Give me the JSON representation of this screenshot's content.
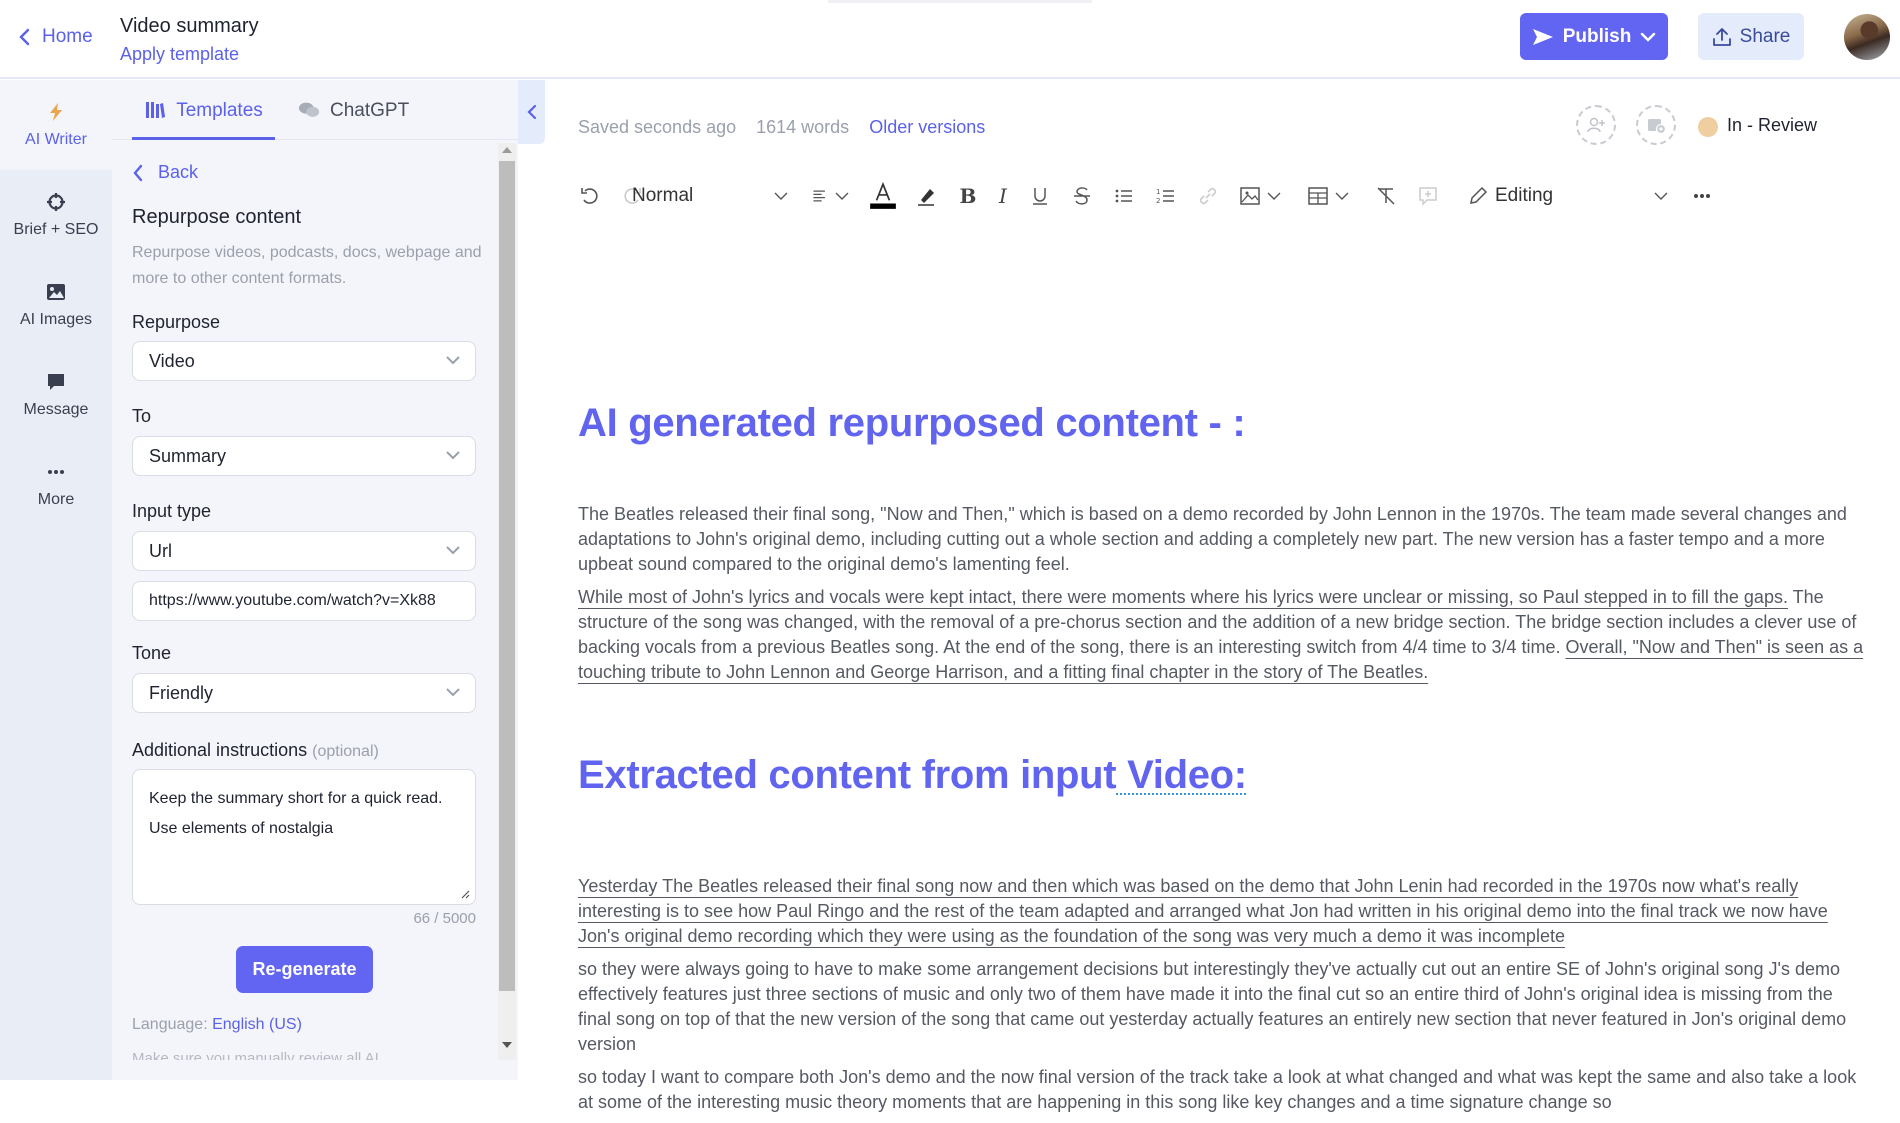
{
  "header": {
    "home_label": "Home",
    "doc_title": "Video summary",
    "apply_template_label": "Apply template",
    "publish_label": "Publish",
    "share_label": "Share",
    "accent_color": "#6264f2"
  },
  "rail": {
    "items": [
      {
        "label": "AI Writer",
        "icon": "lightning-icon",
        "active": true
      },
      {
        "label": "Brief + SEO",
        "icon": "crosshair-icon",
        "active": false
      },
      {
        "label": "AI Images",
        "icon": "image-icon",
        "active": false
      },
      {
        "label": "Message",
        "icon": "message-icon",
        "active": false
      },
      {
        "label": "More",
        "icon": "more-dots-icon",
        "active": false
      }
    ]
  },
  "panel": {
    "tabs": [
      {
        "label": "Templates",
        "icon": "books-icon",
        "active": true
      },
      {
        "label": "ChatGPT",
        "icon": "chat-bubbles-icon",
        "active": false
      }
    ],
    "back_label": "Back",
    "title": "Repurpose content",
    "description": "Repurpose videos, podcasts, docs, webpage and more to other content formats.",
    "fields": {
      "repurpose": {
        "label": "Repurpose",
        "value": "Video"
      },
      "to": {
        "label": "To",
        "value": "Summary"
      },
      "input_type": {
        "label": "Input type",
        "value": "Url"
      },
      "url": {
        "value": "https://www.youtube.com/watch?v=Xk88"
      },
      "tone": {
        "label": "Tone",
        "value": "Friendly"
      },
      "instructions": {
        "label": "Additional instructions",
        "optional_label": "(optional)",
        "value": "Keep the summary short for a quick read.\nUse elements of nostalgia",
        "char_count": "66 / 5000"
      }
    },
    "regenerate_label": "Re-generate",
    "language_prefix": "Language:",
    "language_value": "English (US)",
    "disclaimer": "Make sure you manually review all AI"
  },
  "editor": {
    "saved_status": "Saved seconds ago",
    "word_count": "1614 words",
    "older_versions_label": "Older versions",
    "status_label": "In - Review",
    "status_color": "#efcfa0",
    "toolbar": {
      "style_value": "Normal",
      "editing_mode": "Editing"
    },
    "content": {
      "heading1": "AI generated repurposed content - :",
      "p1": "The Beatles released their final song, \"Now and Then,\" which is based on a demo recorded by John Lennon in the 1970s. The team made several changes and adaptations to John's original demo, including cutting out a whole section and adding a completely new part. The new version has a faster tempo and a more upbeat sound compared to the original demo's lamenting feel.",
      "p2_red": "While most of John's lyrics and vocals were kept intact, there were moments where his lyrics were unclear or missing, so Paul stepped in to fill the gaps.",
      "p2_plain": " The structure of the song was changed, with the removal of a pre-chorus section and the addition of a new bridge section. The bridge section includes a clever use of backing vocals from a previous Beatles song. At the end of the song, there is an interesting switch from 4/4 time to 3/4 time. ",
      "p2_blue": "Overall, \"Now and Then\" is seen as a touching tribute to John Lennon and George Harrison, and a fitting final chapter in the story of The Beatles.",
      "heading2_a": "Extracted content from input",
      "heading2_b": " Video:",
      "p3_red": "Yesterday The Beatles released their final song now and then which was based on the demo that John Lenin had recorded in the 1970s now what's really interesting is to see how Paul Ringo and the rest of the team adapted and arranged what Jon had written in his original demo into the final track we now have Jon's original demo recording which they were using as the foundation of the song was very much a demo it was incomplete",
      "p4": "so they were always going to have to make some arrangement decisions but interestingly they've actually cut out an entire SE of John's original song J's demo effectively features just three sections of music and only two of them have made it into the final cut so an entire third of John's original idea is missing from the final song on top of that the new version of the song that came out yesterday actually features an entirely new section that never featured in Jon's original demo version",
      "p5": "so today I want to compare both Jon's demo and the now final version of the track take a look at what changed and what was kept the same and also take a look at some of the interesting music theory moments that are happening in this song like key changes and a time signature change so"
    }
  }
}
